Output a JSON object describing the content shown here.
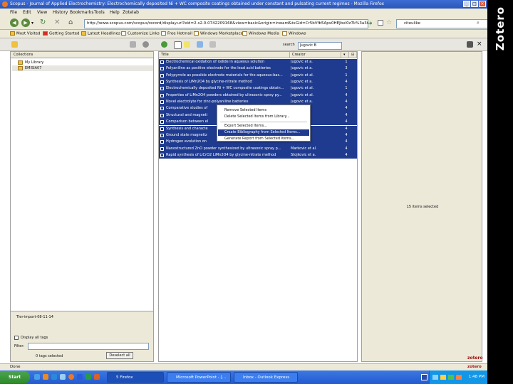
{
  "browser": {
    "title": "Scopus - Journal of Applied Electrochemistry: Electrochemically deposited Ni + WC composite coatings obtained under constant and pulsating current regimes - Mozilla Firefox",
    "menu": [
      "File",
      "Edit",
      "View",
      "History",
      "Bookmarks",
      "Tools",
      "Help",
      "Zotelab"
    ],
    "url": "http://www.scopus.com/scopus/record/display.url?eid=2-s2.0-0742209168&view=basic&origin=inward&txGid=Cr5bVfb5Apx0HEJbxI0z7k%3a36",
    "search_value": "citeulike",
    "bookmarks": [
      "Most Visited",
      "Getting Started",
      "Latest Headlines",
      "Customize Links",
      "Free Hotmail",
      "Windows Marketplace",
      "Windows Media",
      "Windows"
    ],
    "status": "Done"
  },
  "zotero": {
    "search_label": "search",
    "search_value": "Jugovic B",
    "collections_header": "Collections",
    "collections": [
      "My Library",
      "EMISIA07"
    ],
    "columns": {
      "title": "Title",
      "creator": "Creator"
    },
    "items": [
      {
        "title": "Electrochemical oxidation of iodide in aqueous solution",
        "creator": "Jugovic et a.",
        "n": "1"
      },
      {
        "title": "Polyaniline as positive electrode for the lead acid batteries",
        "creator": "Jugovic et a.",
        "n": "3"
      },
      {
        "title": "Polypyrrole as possible electrode materials for the aqueous-bas...",
        "creator": "Jugovic et al.",
        "n": "1"
      },
      {
        "title": "Synthesis of LiMn2O4 by glycine-nitrate method",
        "creator": "Jugovic et a.",
        "n": "4"
      },
      {
        "title": "Electrochemically deposited Ni + WC composite coatings obtain...",
        "creator": "Jugovic et al.",
        "n": "1"
      },
      {
        "title": "Properties of LiMn2O4 powders obtained by ultrasonic spray py...",
        "creator": "Jugovic et al.",
        "n": "4"
      },
      {
        "title": "Novel electrolyte for zinc-polyaniline batteries",
        "creator": "Jugovic et a.",
        "n": "4"
      },
      {
        "title": "Comparative studies of",
        "creator": "",
        "n": "4"
      },
      {
        "title": "Structural and magneti",
        "creator": "",
        "n": "4"
      },
      {
        "title": "Comparison between el",
        "creator": "",
        "n": "4"
      },
      {
        "title": "Synthesis and characte",
        "creator": "",
        "n": "4"
      },
      {
        "title": "Ground state magnetiz",
        "creator": "",
        "n": "4"
      },
      {
        "title": "Hydrogen evolution on",
        "creator": "",
        "n": "4"
      },
      {
        "title": "Nanostructured ZnO powder synthesized by ultrasonic spray p...",
        "creator": "Markovic et al.",
        "n": "4"
      },
      {
        "title": "Rapid synthesis of LiCrO2 LiMn2O4 by glycine-nitrate method",
        "creator": "Stojkovic et a.",
        "n": "4"
      }
    ],
    "context_menu": [
      "Remove Selected Items",
      "Delete Selected Items from Library...",
      "Export Selected Items...",
      "Create Bibliography from Selected Items...",
      "Generate Report from Selected Items..."
    ],
    "tag_filter_label": "Filter:",
    "tag_heading": "Tier-import-08-11-14",
    "display_all_tags": "Display all tags",
    "tags_selected": "0 tags selected",
    "deselect_all": "Deselect all",
    "items_selected": "15 items selected",
    "logo": "zotero"
  },
  "taskbar": {
    "start": "Start",
    "tasks": [
      "5 Firefox",
      "Microsoft PowerPoint - […",
      "Inbox - Outlook Express"
    ],
    "clock": "1:48 PM"
  },
  "side_label": "Zotero",
  "colors": {
    "selection": "#1f3b8f",
    "titlebar": "#2a56b8",
    "taskbar": "#245ad0"
  }
}
